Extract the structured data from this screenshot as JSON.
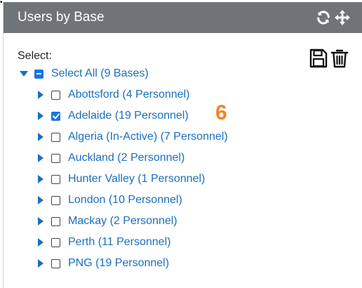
{
  "panel": {
    "title": "Users by Base",
    "select_label": "Select:"
  },
  "icons": {
    "header": [
      "refresh-icon",
      "move-icon"
    ],
    "actions": [
      "save-icon",
      "trash-icon"
    ]
  },
  "tree": {
    "root": {
      "label": "Select All (9 Bases)",
      "state": "partial",
      "expanded": true
    },
    "items": [
      {
        "label": "Abottsford (4 Personnel)",
        "checked": false
      },
      {
        "label": "Adelaide (19 Personnel)",
        "checked": true
      },
      {
        "label": "Algeria (In-Active) (7 Personnel)",
        "checked": false
      },
      {
        "label": "Auckland (2 Personnel)",
        "checked": false
      },
      {
        "label": "Hunter Valley (1 Personnel)",
        "checked": false
      },
      {
        "label": "London (10 Personnel)",
        "checked": false
      },
      {
        "label": "Mackay (2 Personnel)",
        "checked": false
      },
      {
        "label": "Perth (11 Personnel)",
        "checked": false
      },
      {
        "label": "PNG (19 Personnel)",
        "checked": false
      }
    ]
  },
  "selection_badge": "6",
  "colors": {
    "header_bg": "#6f7479",
    "link": "#1a6fc0",
    "accent": "#1a73e8",
    "badge": "#f58220"
  }
}
